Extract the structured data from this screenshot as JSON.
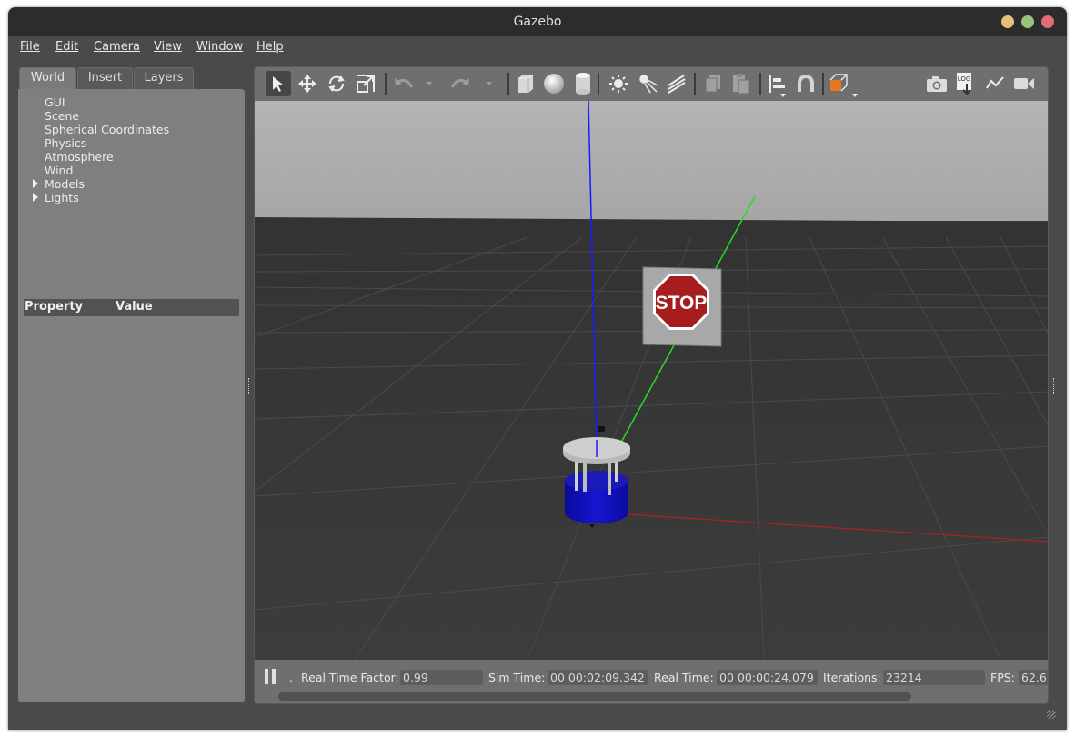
{
  "window": {
    "title": "Gazebo"
  },
  "menu": [
    {
      "label": "File"
    },
    {
      "label": "Edit"
    },
    {
      "label": "Camera"
    },
    {
      "label": "View"
    },
    {
      "label": "Window"
    },
    {
      "label": "Help"
    }
  ],
  "left_tabs": [
    {
      "label": "World"
    },
    {
      "label": "Insert"
    },
    {
      "label": "Layers"
    }
  ],
  "world_tree": [
    {
      "label": "GUI"
    },
    {
      "label": "Scene"
    },
    {
      "label": "Spherical Coordinates"
    },
    {
      "label": "Physics"
    },
    {
      "label": "Atmosphere"
    },
    {
      "label": "Wind"
    },
    {
      "label": "Models"
    },
    {
      "label": "Lights"
    }
  ],
  "property_table": {
    "col_property": "Property",
    "col_value": "Value"
  },
  "toolbar": {
    "tools": [
      "select-arrow-icon",
      "translate-icon",
      "rotate-icon",
      "scale-icon",
      "undo-icon",
      "redo-icon",
      "box-icon",
      "sphere-icon",
      "cylinder-icon",
      "point-light-icon",
      "spot-light-icon",
      "directional-light-icon",
      "copy-icon",
      "paste-icon",
      "align-icon",
      "snap-magnet-icon",
      "view-angle-icon",
      "screenshot-icon",
      "log-icon",
      "plot-icon",
      "record-video-icon"
    ],
    "log_text": "LOG"
  },
  "scene": {
    "sign_text": "STOP"
  },
  "status": {
    "rtf_label": "Real Time Factor:",
    "rtf_value": "0.99",
    "sim_label": "Sim Time:",
    "sim_value": "00 00:02:09.342",
    "real_label": "Real Time:",
    "real_value": "00 00:00:24.079",
    "iter_label": "Iterations:",
    "iter_value": "23214",
    "fps_label": "FPS:",
    "fps_value": "62.6",
    "step_hint": "."
  },
  "colors": {
    "close": "#e06c75",
    "minimize": "#e5c07b",
    "maximize": "#98c379",
    "accent_orange": "#e8761e"
  }
}
